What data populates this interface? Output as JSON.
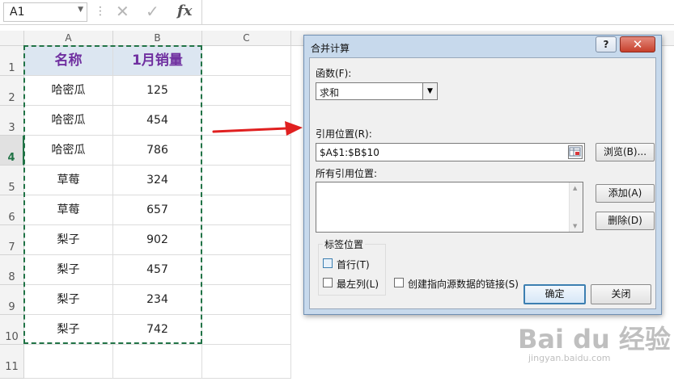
{
  "formula_bar": {
    "name_box": "A1",
    "cancel_glyph": "✕",
    "enter_glyph": "✓",
    "fx_label": "fx"
  },
  "sheet": {
    "columns": [
      "A",
      "B",
      "C"
    ],
    "rows": [
      "1",
      "2",
      "3",
      "4",
      "5",
      "6",
      "7",
      "8",
      "9",
      "10",
      "11"
    ],
    "selected_row": "4",
    "header": [
      "名称",
      "1月销量"
    ],
    "data": [
      [
        "哈密瓜",
        "125"
      ],
      [
        "哈密瓜",
        "454"
      ],
      [
        "哈密瓜",
        "786"
      ],
      [
        "草莓",
        "324"
      ],
      [
        "草莓",
        "657"
      ],
      [
        "梨子",
        "902"
      ],
      [
        "梨子",
        "457"
      ],
      [
        "梨子",
        "234"
      ],
      [
        "梨子",
        "742"
      ]
    ]
  },
  "dialog": {
    "title": "合并计算",
    "help": "?",
    "close": "✕",
    "function_label": "函数(F):",
    "function_value": "求和",
    "ref_label": "引用位置(R):",
    "ref_value": "$A$1:$B$10",
    "all_refs_label": "所有引用位置:",
    "browse": "浏览(B)...",
    "add": "添加(A)",
    "delete": "删除(D)",
    "label_group": "标签位置",
    "first_row": "首行(T)",
    "left_col": "最左列(L)",
    "link": "创建指向源数据的链接(S)",
    "ok": "确定",
    "cancel": "关闭"
  },
  "watermark": {
    "text": "Bai du 经验",
    "sub": "jingyan.baidu.com"
  },
  "colors": {
    "header_fill": "#dce6f1",
    "header_text": "#7030a0",
    "marquee": "#217346",
    "arrow": "#e02020"
  }
}
